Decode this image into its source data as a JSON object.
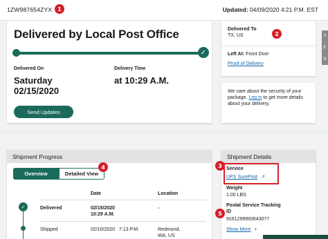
{
  "header": {
    "tracking_number": "1ZW987654ZYX",
    "updated_label": "Updated:",
    "updated_value": "04/09/2020 4:21 P.M. EST"
  },
  "badges": {
    "b1": "1",
    "b2": "2",
    "b3": "3",
    "b4": "4",
    "b5": "5"
  },
  "status": {
    "title": "Delivered by Local Post Office",
    "check": "✓",
    "delivered_on_label": "Delivered On",
    "delivered_day": "Saturday",
    "delivered_date": "02/15/2020",
    "delivery_time_label": "Delivery Time",
    "delivery_time": "at 10:29 A.M.",
    "send_updates_label": "Send Updates"
  },
  "delivered_to": {
    "label": "Delivered To",
    "location": "TX, US",
    "left_at_label": "Left At:",
    "left_at_value": "Front Door",
    "proof_link": "Proof of Delivery"
  },
  "security": {
    "line1": "We care about the security of your",
    "line2_pre": "package.",
    "login_link": "Log in",
    "line2_post": "to get more details",
    "line3": "about your delivery."
  },
  "side_tab": {
    "glyphs": [
      "≡",
      "E",
      "S"
    ]
  },
  "shipment_progress": {
    "header": "Shipment Progress",
    "tab_overview": "Overview",
    "tab_detailed": "Detailed View",
    "columns": {
      "date": "Date",
      "location": "Location"
    },
    "rows": [
      {
        "status": "Delivered",
        "date": "02/15/2020",
        "time": "10:29 A.M.",
        "location": "-"
      },
      {
        "status": "Shipped",
        "date": "02/10/2020",
        "time": "7:13 P.M.",
        "location_line1": "Redmond,",
        "location_line2": "WA, US"
      }
    ]
  },
  "shipment_details": {
    "header": "Shipment Details",
    "service_label": "Service",
    "service_value": "UPS SurePost",
    "ext_icon": "↗",
    "weight_label": "Weight",
    "weight_value": "1.00 LBS",
    "postal_label_line1": "Postal Service Tracking",
    "postal_label_line2": "ID",
    "postal_value": "9161299993643077",
    "show_more": "Show More",
    "plus": "+"
  },
  "colors": {
    "accent": "#1b6b5b",
    "badge": "#d4202a",
    "link": "#1463a8"
  }
}
